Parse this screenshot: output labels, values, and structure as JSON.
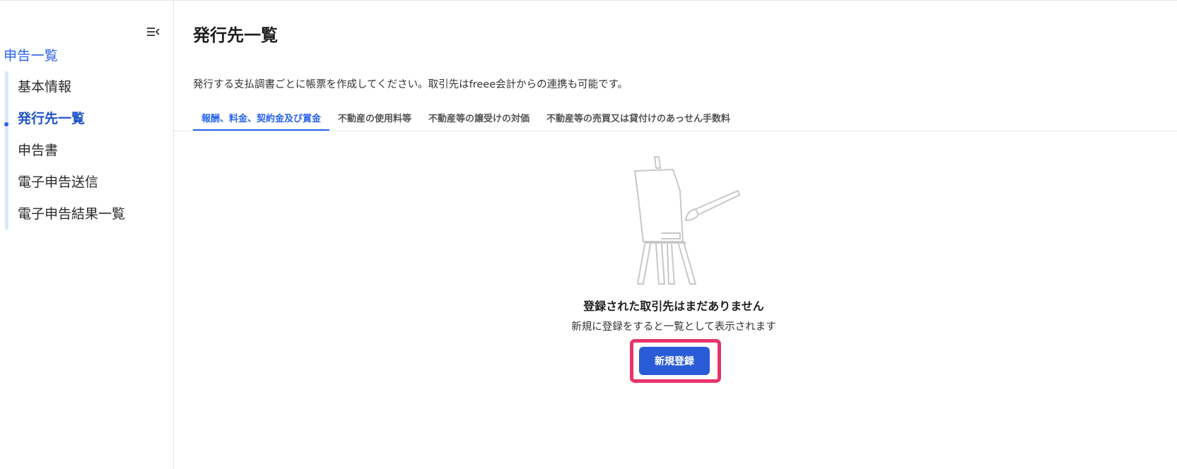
{
  "sidebar": {
    "collapse_icon": "menu-collapse-icon",
    "parent_link": "申告一覧",
    "items": [
      {
        "label": "基本情報"
      },
      {
        "label": "発行先一覧",
        "active": true
      },
      {
        "label": "申告書"
      },
      {
        "label": "電子申告送信"
      },
      {
        "label": "電子申告結果一覧"
      }
    ]
  },
  "main": {
    "title": "発行先一覧",
    "description": "発行する支払調書ごとに帳票を作成してください。取引先はfreee会計からの連携も可能です。",
    "tabs": [
      {
        "label": "報酬、料金、契約金及び賞金",
        "active": true
      },
      {
        "label": "不動産の使用料等"
      },
      {
        "label": "不動産等の譲受けの対価"
      },
      {
        "label": "不動産等の売買又は貸付けのあっせん手数料"
      }
    ],
    "empty_state": {
      "illustration": "easel-painting-icon",
      "title": "登録された取引先はまだありません",
      "description": "新規に登録をすると一覧として表示されます",
      "button_label": "新規登録"
    }
  },
  "colors": {
    "accent": "#2864f0",
    "button": "#2a5bd7",
    "highlight": "#e8336a"
  }
}
